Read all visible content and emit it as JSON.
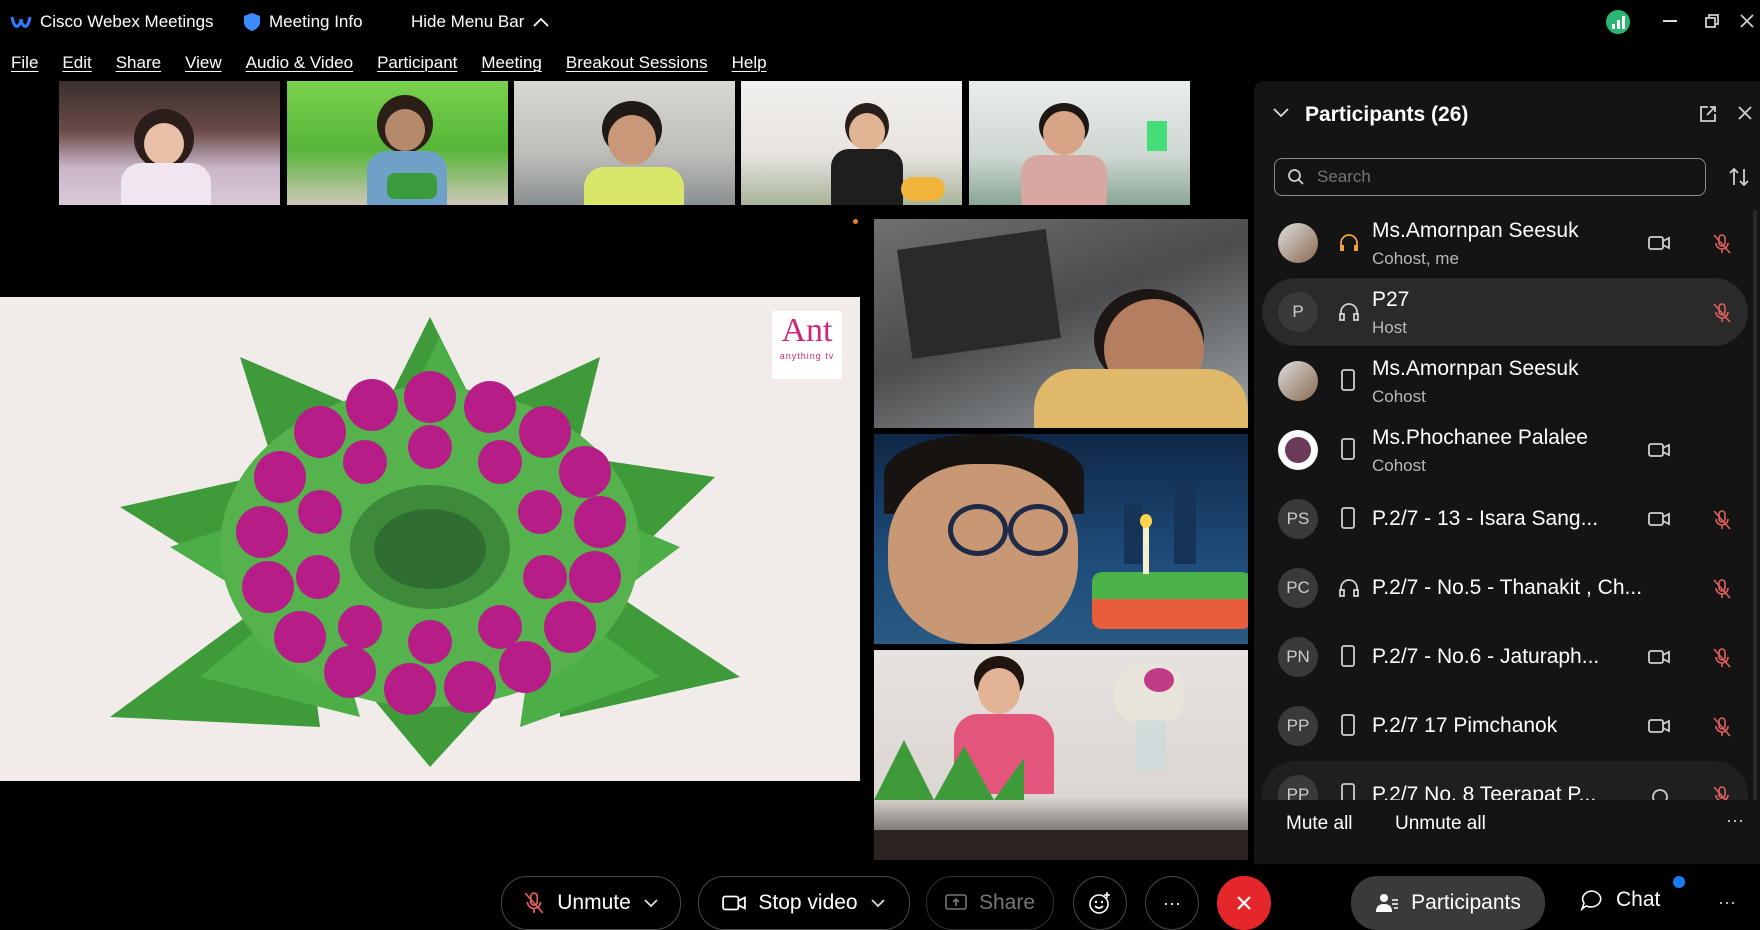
{
  "titlebar": {
    "app_name": "Cisco Webex Meetings",
    "meeting_info": "Meeting Info",
    "hide_menu_bar": "Hide Menu Bar"
  },
  "menu": [
    "File",
    "Edit",
    "Share",
    "View",
    "Audio & Video",
    "Participant",
    "Meeting",
    "Breakout Sessions",
    "Help"
  ],
  "stage": {
    "watermark_brand": "Ant",
    "watermark_sub": "anything tv"
  },
  "panel": {
    "title": "Participants (26)",
    "search_placeholder": "Search",
    "participants": [
      {
        "name": "Ms.Amornpan Seesuk",
        "role": "Cohost, me",
        "initials": ""
      },
      {
        "name": "P27",
        "role": "Host",
        "initials": "P"
      },
      {
        "name": "Ms.Amornpan Seesuk",
        "role": "Cohost",
        "initials": ""
      },
      {
        "name": "Ms.Phochanee Palalee",
        "role": "Cohost",
        "initials": ""
      },
      {
        "name": "P.2/7 - 13 - Isara Sang...",
        "role": "",
        "initials": "PS"
      },
      {
        "name": "P.2/7 - No.5 - Thanakit , Ch...",
        "role": "",
        "initials": "PC"
      },
      {
        "name": "P.2/7 - No.6 - Jaturaph...",
        "role": "",
        "initials": "PN"
      },
      {
        "name": "P.2/7 17 Pimchanok",
        "role": "",
        "initials": "PP"
      },
      {
        "name": "P.2/7 No. 8 Teerapat P...",
        "role": "",
        "initials": "PP"
      }
    ],
    "mute_all": "Mute all",
    "unmute_all": "Unmute all"
  },
  "bottombar": {
    "unmute": "Unmute",
    "stop_video": "Stop video",
    "share": "Share",
    "participants": "Participants",
    "chat": "Chat"
  },
  "colors": {
    "end_call": "#e5262b",
    "accent_blue": "#1a7cf4",
    "muted_red": "#e06060",
    "signal_green": "#2bb673"
  }
}
